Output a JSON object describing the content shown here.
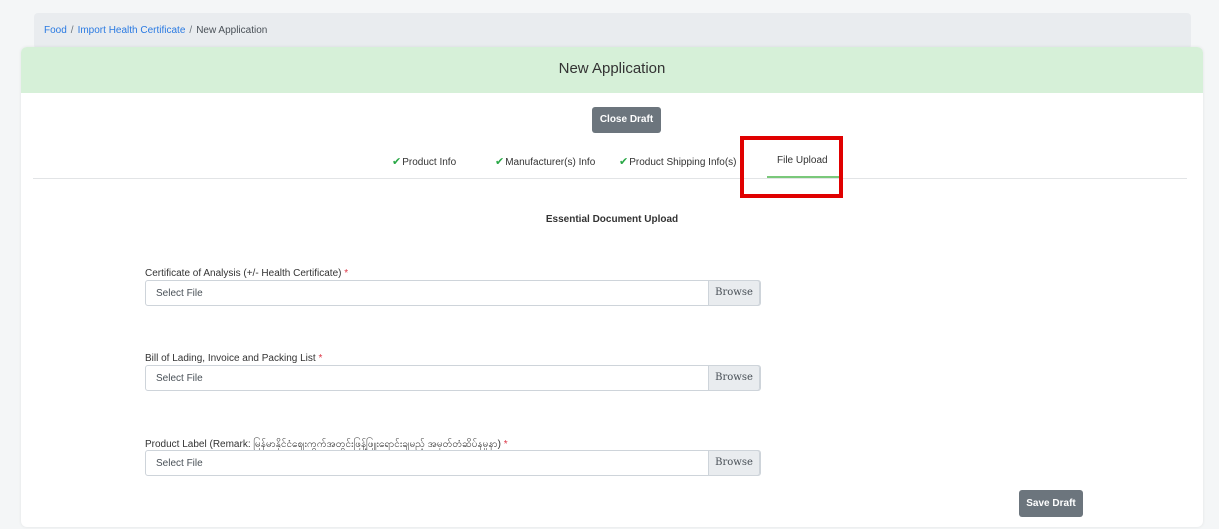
{
  "breadcrumb": {
    "items": [
      "Food",
      "Import Health Certificate"
    ],
    "separator": "/",
    "current": "New Application"
  },
  "header": {
    "title": "New Application"
  },
  "actions": {
    "close_draft": "Close Draft",
    "save_draft": "Save Draft"
  },
  "tabs": [
    {
      "label": "Product Info",
      "completed": true
    },
    {
      "label": "Manufacturer(s) Info",
      "completed": true
    },
    {
      "label": "Product Shipping Info(s)",
      "completed": true
    },
    {
      "label": "File Upload",
      "active": true
    }
  ],
  "section": {
    "title": "Essential Document Upload"
  },
  "fields": [
    {
      "label": "Certificate of Analysis (+/- Health Certificate)",
      "required_mark": "*",
      "placeholder": "Select File",
      "browse": "Browse"
    },
    {
      "label": "Bill of Lading, Invoice and Packing List",
      "required_mark": "*",
      "placeholder": "Select File",
      "browse": "Browse"
    },
    {
      "label": "Product Label (Remark: မြန်မာနိုင်ငံဈေးကွက်အတွင်းဖြန့်ဖြူးရောင်းချမည့် အမှတ်တံဆိပ်နမူနာ)",
      "required_mark": "*",
      "placeholder": "Select File",
      "browse": "Browse"
    }
  ],
  "colors": {
    "header_bg": "#d6f0d8",
    "button_bg": "#6c757d",
    "check": "#28a745",
    "link": "#2a7ae2",
    "required": "#dc3545",
    "highlight": "#e00000",
    "active_tab_underline": "#7ac87a"
  },
  "icons": {
    "tab_complete": "checkmark-icon"
  }
}
